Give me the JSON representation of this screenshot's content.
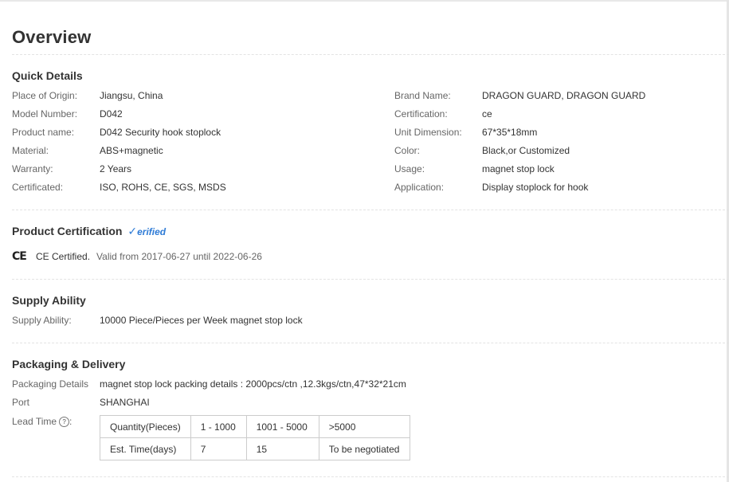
{
  "overview_title": "Overview",
  "quick_details": {
    "title": "Quick Details",
    "left": [
      {
        "label": "Place of Origin:",
        "value": "Jiangsu, China"
      },
      {
        "label": "Model Number:",
        "value": "D042"
      },
      {
        "label": "Product name:",
        "value": "D042 Security hook stoplock"
      },
      {
        "label": "Material:",
        "value": "ABS+magnetic"
      },
      {
        "label": "Warranty:",
        "value": "2 Years"
      },
      {
        "label": "Certificated:",
        "value": "ISO, ROHS, CE, SGS, MSDS"
      }
    ],
    "right": [
      {
        "label": "Brand Name:",
        "value": "DRAGON GUARD, DRAGON GUARD"
      },
      {
        "label": "Certification:",
        "value": "ce"
      },
      {
        "label": "Unit Dimension:",
        "value": "67*35*18mm"
      },
      {
        "label": "Color:",
        "value": "Black,or Customized"
      },
      {
        "label": "Usage:",
        "value": "magnet stop lock"
      },
      {
        "label": "Application:",
        "value": "Display stoplock for hook"
      }
    ]
  },
  "product_certification": {
    "title": "Product Certification",
    "verified_mark": "✓",
    "verified_label": "erified",
    "ce_logo": "CE",
    "ce_label": "CE Certified.",
    "validity": "Valid from 2017-06-27 until 2022-06-26"
  },
  "supply_ability": {
    "title": "Supply Ability",
    "label": "Supply Ability:",
    "value": "10000 Piece/Pieces per Week magnet stop lock"
  },
  "packaging_delivery": {
    "title": "Packaging & Delivery",
    "packaging_label": "Packaging Details",
    "packaging_value": "magnet stop lock packing details : 2000pcs/ctn ,12.3kgs/ctn,47*32*21cm",
    "port_label": "Port",
    "port_value": "SHANGHAI",
    "lead_time_label": "Lead Time",
    "help_icon": "?",
    "lead_table": {
      "row1": [
        "Quantity(Pieces)",
        "1 - 1000",
        "1001 - 5000",
        ">5000"
      ],
      "row2": [
        "Est. Time(days)",
        "7",
        "15",
        "To be negotiated"
      ]
    }
  }
}
